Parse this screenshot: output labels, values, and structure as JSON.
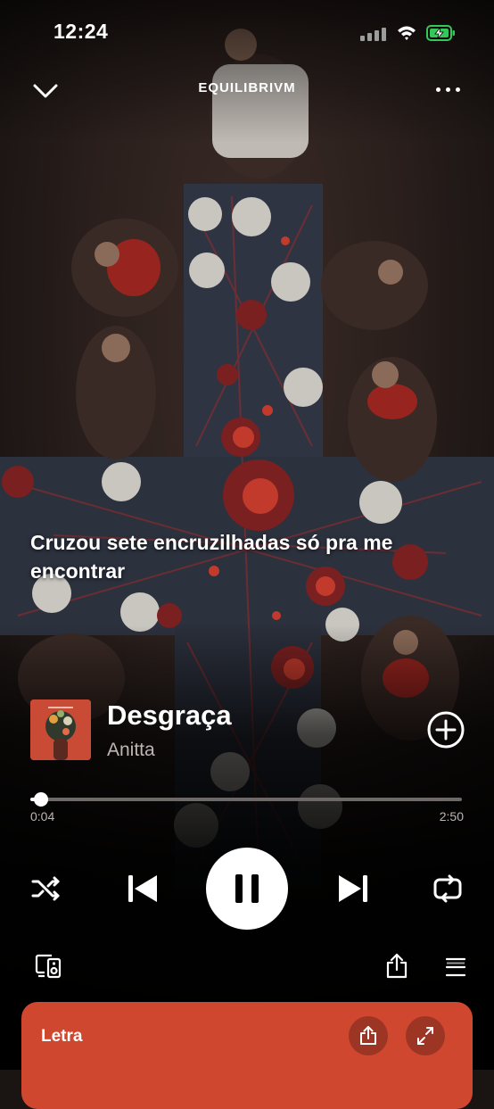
{
  "status_bar": {
    "time": "12:24",
    "battery_state": "charging",
    "battery_color": "#34c759"
  },
  "header": {
    "context_title": "EQUILIBRIVM",
    "collapse_icon": "chevron-down-icon",
    "more_icon": "more-horizontal-icon"
  },
  "lyric_line": "Cruzou sete encruzilhadas só pra me encontrar",
  "track": {
    "title": "Desgraça",
    "artist": "Anitta",
    "cover_color": "#c94a35",
    "add_icon": "plus-circle-icon"
  },
  "playback": {
    "elapsed": "0:04",
    "total": "2:50",
    "progress_fraction": 0.024,
    "state": "playing",
    "controls": [
      "shuffle-icon",
      "previous-icon",
      "pause-icon",
      "next-icon",
      "repeat-icon"
    ]
  },
  "bottom_row": {
    "icons": [
      "devices-icon",
      "share-icon",
      "queue-icon"
    ]
  },
  "lyrics_card": {
    "label": "Letra",
    "background": "#d0472f",
    "icons": [
      "share-icon",
      "expand-icon"
    ]
  }
}
